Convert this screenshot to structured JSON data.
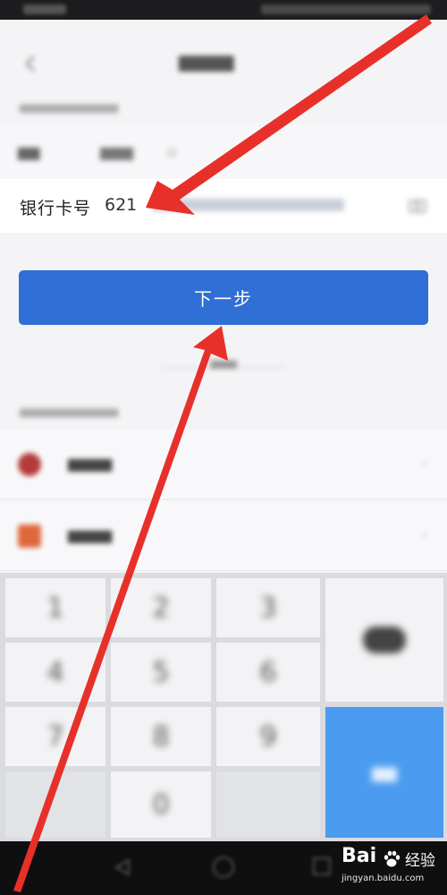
{
  "card_input": {
    "label": "银行卡号",
    "value_visible": "621"
  },
  "next_button": {
    "label": "下一步",
    "color": "#2f6fd6"
  },
  "keypad": {
    "keys": [
      "1",
      "2",
      "3",
      "4",
      "5",
      "6",
      "7",
      "8",
      "9",
      "0"
    ],
    "delete_icon": "backspace-icon",
    "confirm_color": "#4b9cf0"
  },
  "watermark": {
    "brand": "Bai",
    "suffix": "经验",
    "url": "jingyan.baidu.com",
    "icon": "paw-icon"
  },
  "annotation": {
    "arrow_color": "#e8302a",
    "arrows": [
      "arrow-to-card-number",
      "arrow-to-next-button"
    ]
  },
  "icons": {
    "back": "chevron-left-icon",
    "camera": "camera-icon",
    "bank_list_chevron": "chevron-right-icon"
  }
}
